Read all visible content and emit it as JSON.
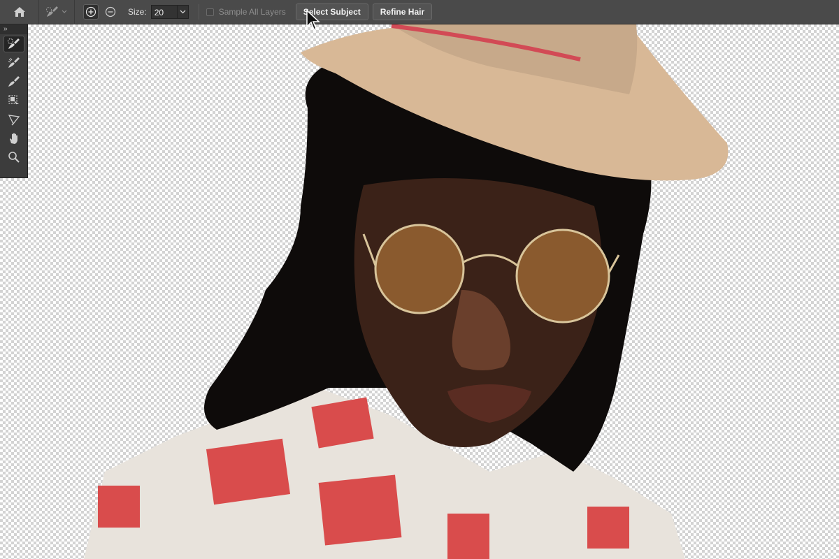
{
  "options_bar": {
    "home_icon": "home-icon",
    "brush_preset_icon": "quick-selection-brush-icon",
    "add_mode_icon": "add-to-selection-icon",
    "subtract_mode_icon": "subtract-from-selection-icon",
    "size_label": "Size:",
    "size_value": "20",
    "sample_all_layers_label": "Sample All Layers",
    "sample_all_layers_checked": false,
    "select_subject_label": "Select Subject",
    "refine_hair_label": "Refine Hair"
  },
  "tool_panel": {
    "collapse_label": "››",
    "tools": [
      {
        "name": "quick-selection-tool",
        "icon": "quick-selection-brush-icon",
        "active": true
      },
      {
        "name": "refine-edge-brush-tool",
        "icon": "refine-edge-brush-icon",
        "active": false
      },
      {
        "name": "brush-tool",
        "icon": "brush-icon",
        "active": false
      },
      {
        "name": "object-selection-tool",
        "icon": "object-selection-icon",
        "active": false
      },
      {
        "name": "lasso-tool",
        "icon": "lasso-icon",
        "active": false
      },
      {
        "name": "hand-tool",
        "icon": "hand-icon",
        "active": false
      },
      {
        "name": "zoom-tool",
        "icon": "zoom-icon",
        "active": false
      }
    ]
  },
  "colors": {
    "toolbar_bg": "#4a4a4a",
    "panel_bg": "#3c3c3c",
    "transparency_checker": "#d3d3d3"
  }
}
